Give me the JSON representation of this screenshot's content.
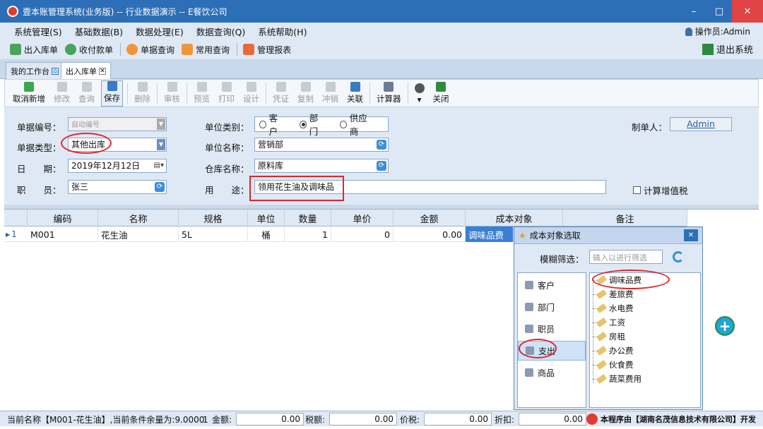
{
  "window": {
    "title": "壹本账管理系统(业务版) -- 行业数据演示 -- E餐饮公司",
    "minimize": "–",
    "maximize": "□",
    "close": "✕"
  },
  "menu": [
    "系统管理(S)",
    "基础数据(B)",
    "数据处理(E)",
    "数据查询(Q)",
    "系统帮助(H)"
  ],
  "operator": "操作员:Admin",
  "quickbar": {
    "items": [
      "出入库单",
      "收付款单",
      "单据查询",
      "常用查询",
      "管理报表"
    ],
    "exit": "退出系统"
  },
  "tabs": {
    "workbench": "我的工作台",
    "inout": "出入库单"
  },
  "toolbar": {
    "cancel_new": "取消新增",
    "edit": "修改",
    "query": "查询",
    "save": "保存",
    "delete": "删除",
    "audit": "审核",
    "preview": "预览",
    "print": "打印",
    "design": "设计",
    "voucher": "凭证",
    "copy": "复制",
    "reverse": "冲销",
    "link": "关联",
    "calculator": "计算器",
    "close": "关闭"
  },
  "form": {
    "doc_no_label": "单据编号：",
    "doc_no_value": "自动编号",
    "doc_type_label": "单据类型：",
    "doc_type_value": "其他出库",
    "date_label": "日　　期：",
    "date_value": "2019年12月12日",
    "staff_label": "职　　员：",
    "staff_value": "张三",
    "unit_cat_label": "单位类别：",
    "unit_cat_options": [
      "客户",
      "部门",
      "供应商"
    ],
    "unit_name_label": "单位名称：",
    "unit_name_value": "营销部",
    "warehouse_label": "仓库名称：",
    "warehouse_value": "原料库",
    "purpose_label": "用　　途：",
    "purpose_value": "领用花生油及调味品",
    "creator_label": "制单人：",
    "creator_value": "Admin",
    "vat_label": "计算增值税"
  },
  "grid": {
    "headers": [
      "编码",
      "名称",
      "规格",
      "单位",
      "数量",
      "单价",
      "金额",
      "成本对象",
      "备注"
    ],
    "row": {
      "index": "1",
      "code": "M001",
      "name": "花生油",
      "spec": "5L",
      "unit": "桶",
      "qty": "1",
      "price": "0",
      "amount": "0.00",
      "cost_obj": "调味品费"
    }
  },
  "popup": {
    "title": "成本对象选取",
    "filter_label": "模糊筛选：",
    "filter_placeholder": "输入以进行筛选",
    "categories": [
      "客户",
      "部门",
      "职员",
      "支出",
      "商品"
    ],
    "items": [
      "调味品费",
      "差旅费",
      "水电费",
      "工资",
      "房租",
      "办公费",
      "伙食费",
      "蔬菜费用"
    ]
  },
  "status": {
    "current": "当前名称【M001-花生油】,当前条件余量为:9.0000",
    "count": "1",
    "amount_label": "金额:",
    "amount_value": "0.00",
    "tax_label": "税额:",
    "tax_value": "0.00",
    "price_tax_label": "价税:",
    "price_tax_value": "0.00",
    "discount_label": "折扣:",
    "discount_value": "0.00",
    "brand": "本程序由【湖南名茂信息技术有限公司】开发"
  }
}
